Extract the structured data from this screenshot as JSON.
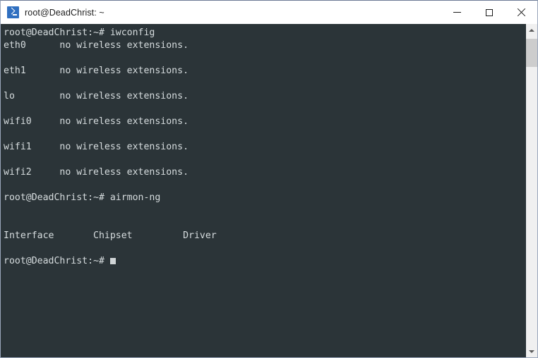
{
  "window": {
    "title": "root@DeadChrist: ~",
    "icon": "terminal-prompt-icon",
    "controls": {
      "minimize_label": "Minimize",
      "maximize_label": "Maximize",
      "close_label": "Close"
    }
  },
  "terminal": {
    "background_color": "#2b3438",
    "foreground_color": "#d6dcde",
    "prompt": "root@DeadChrist:~#",
    "commands": [
      "iwconfig",
      "airmon-ng"
    ],
    "content": "root@DeadChrist:~# iwconfig\neth0      no wireless extensions.\n\neth1      no wireless extensions.\n\nlo        no wireless extensions.\n\nwifi0     no wireless extensions.\n\nwifi1     no wireless extensions.\n\nwifi2     no wireless extensions.\n\nroot@DeadChrist:~# airmon-ng\n\n\nInterface       Chipset         Driver\n\n",
    "last_prompt": "root@DeadChrist:~#",
    "iwconfig_output": [
      {
        "interface": "eth0",
        "message": "no wireless extensions."
      },
      {
        "interface": "eth1",
        "message": "no wireless extensions."
      },
      {
        "interface": "lo",
        "message": "no wireless extensions."
      },
      {
        "interface": "wifi0",
        "message": "no wireless extensions."
      },
      {
        "interface": "wifi1",
        "message": "no wireless extensions."
      },
      {
        "interface": "wifi2",
        "message": "no wireless extensions."
      }
    ],
    "airmon_table": {
      "headers": [
        "Interface",
        "Chipset",
        "Driver"
      ],
      "rows": []
    },
    "cursor": "block"
  },
  "scrollbar": {
    "up_arrow": "scroll-up-arrow",
    "down_arrow": "scroll-down-arrow",
    "thumb": "scroll-thumb"
  }
}
